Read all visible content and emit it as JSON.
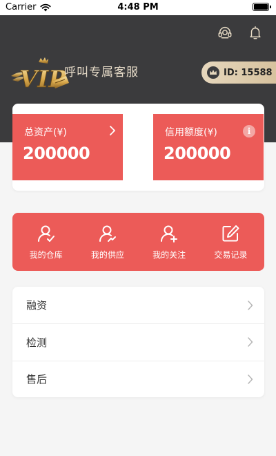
{
  "status_bar": {
    "carrier": "Carrier",
    "time": "4:48 PM"
  },
  "header": {
    "vip_badge_text": "VIP",
    "vip_service_label": "呼叫专属客服",
    "user_id": "ID: 15588",
    "icons": [
      "headset-icon",
      "bell-icon"
    ]
  },
  "assets": {
    "total": {
      "title": "总资产(¥)",
      "value": "200000"
    },
    "credit": {
      "title": "信用额度(¥)",
      "value": "200000",
      "info_glyph": "i"
    }
  },
  "actions": [
    {
      "label": "我的仓库",
      "icon": "user-check-icon"
    },
    {
      "label": "我的供应",
      "icon": "user-trend-icon"
    },
    {
      "label": "我的关注",
      "icon": "user-add-icon"
    },
    {
      "label": "交易记录",
      "icon": "edit-icon"
    }
  ],
  "menu": [
    {
      "label": "融资"
    },
    {
      "label": "检测"
    },
    {
      "label": "售后"
    }
  ],
  "colors": {
    "header_bg": "#3b3b3d",
    "accent_red": "#ec5b58",
    "gold": "#d7c29e",
    "page_bg": "#f5f5f5"
  }
}
